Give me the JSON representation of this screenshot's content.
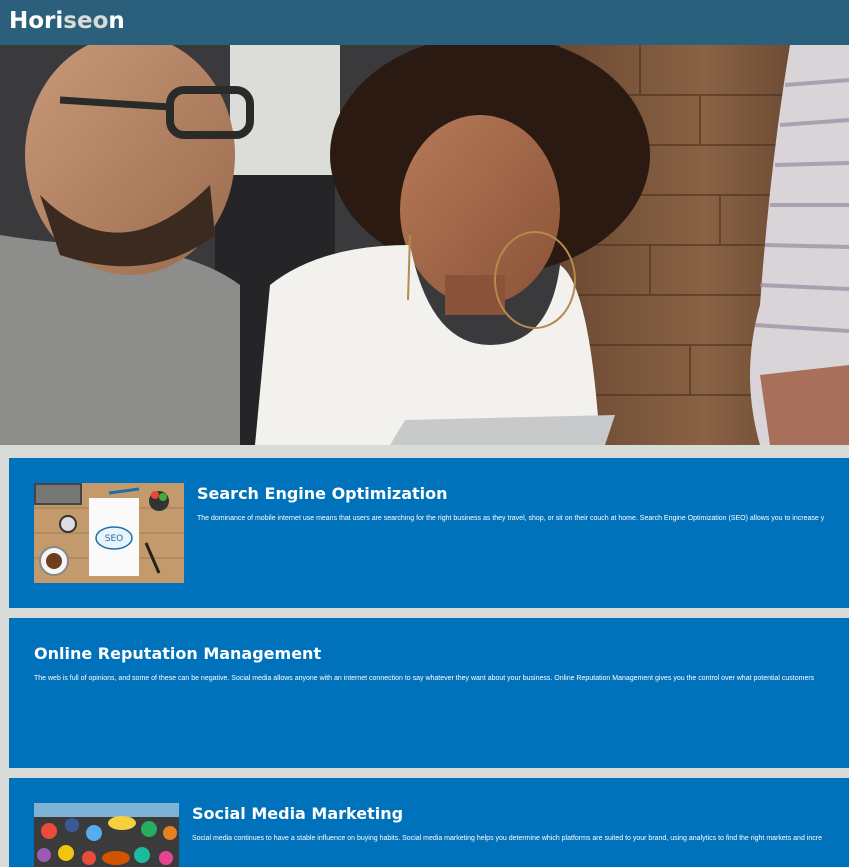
{
  "header": {
    "logo_part1": "Hori",
    "logo_part2": "seo",
    "logo_part3": "n"
  },
  "hero": {
    "image": "three people working together at a laptop"
  },
  "sections": [
    {
      "title": "Search Engine Optimization",
      "text": "The dominance of mobile internet use means that users are searching for the right business as they travel, shop, or sit on their couch at home. Search Engine Optimization (SEO) allows you to increase y",
      "image": "SEO notebook and desk illustration"
    },
    {
      "title": "Online Reputation Management",
      "text": "The web is full of opinions, and some of these can be negative. Social media allows anyone with an internet connection to say whatever they want about your business. Online Reputation Management gives you the control over what potential customers"
    },
    {
      "title": "Social Media Marketing",
      "text": "Social media continues to have a stable influence on buying habits. Social media marketing helps you determine which platforms are suited to your brand, using analytics to find the right markets and incre",
      "image": "social media icons illustration"
    }
  ],
  "colors": {
    "header_bg": "#2a607c",
    "page_bg": "#d9dcd6",
    "card_bg": "#0072bb",
    "text": "#ffffff"
  }
}
